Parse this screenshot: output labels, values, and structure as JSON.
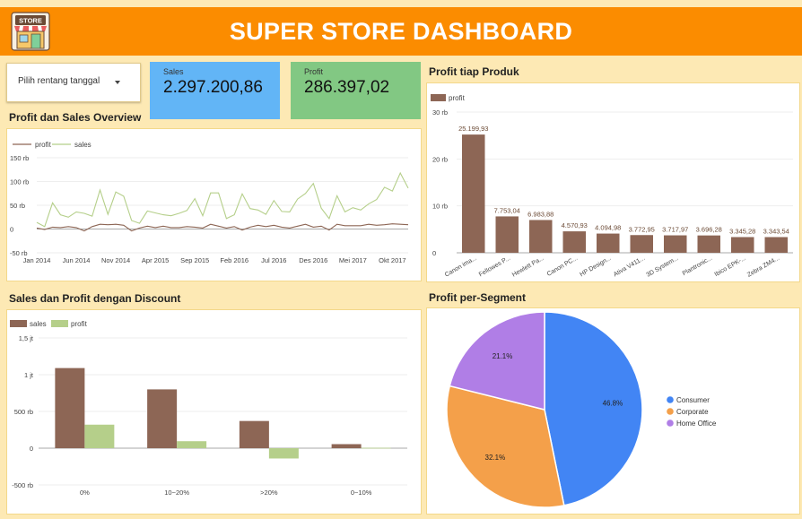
{
  "header": {
    "title": "SUPER STORE DASHBOARD",
    "logo_text": "STORE",
    "logo_icon": "store-icon"
  },
  "date_picker": {
    "label": "Pilih rentang tanggal",
    "icon": "chevron-down-icon"
  },
  "kpis": {
    "sales": {
      "label": "Sales",
      "value": "2.297.200,86"
    },
    "profit": {
      "label": "Profit",
      "value": "286.397,02"
    }
  },
  "colors": {
    "header": "#fb8c00",
    "background": "#fde9b4",
    "sales_card": "#62b5f6",
    "profit_card": "#82c883",
    "brown": "#8d6655",
    "green": "#b5cf8a",
    "consumer": "#4285f4",
    "corporate": "#f4a04a",
    "home_office": "#b07ee6"
  },
  "sections": {
    "overview_title": "Profit dan Sales Overview",
    "discount_title": "Sales dan Profit dengan Discount",
    "product_title": "Profit tiap Produk",
    "segment_title": "Profit per-Segment"
  },
  "chart_data": [
    {
      "id": "overview",
      "type": "line",
      "title": "Profit dan Sales Overview",
      "x": [
        "Jan 2014",
        "Feb 2014",
        "Mar 2014",
        "Apr 2014",
        "May 2014",
        "Jun 2014",
        "Jul 2014",
        "Aug 2014",
        "Sep 2014",
        "Oct 2014",
        "Nov 2014",
        "Dec 2014",
        "Jan 2015",
        "Feb 2015",
        "Mar 2015",
        "Apr 2015",
        "May 2015",
        "Jun 2015",
        "Jul 2015",
        "Aug 2015",
        "Sep 2015",
        "Oct 2015",
        "Nov 2015",
        "Dec 2015",
        "Jan 2016",
        "Feb 2016",
        "Mar 2016",
        "Apr 2016",
        "May 2016",
        "Jun 2016",
        "Jul 2016",
        "Aug 2016",
        "Sep 2016",
        "Oct 2016",
        "Nov 2016",
        "Dec 2016",
        "Jan 2017",
        "Feb 2017",
        "Mar 2017",
        "Apr 2017",
        "May 2017",
        "Jun 2017",
        "Jul 2017",
        "Aug 2017",
        "Sep 2017",
        "Oct 2017",
        "Nov 2017",
        "Dec 2017"
      ],
      "x_tick_labels": [
        "Jan 2014",
        "Jun 2014",
        "Nov 2014",
        "Apr 2015",
        "Sep 2015",
        "Feb 2016",
        "Jul 2016",
        "Des 2016",
        "Mei 2017",
        "Okt 2017"
      ],
      "x_tick_indices": [
        0,
        5,
        10,
        15,
        20,
        25,
        30,
        35,
        40,
        45
      ],
      "y_tick_labels": [
        "150 rb",
        "100 rb",
        "50 rb",
        "0",
        "-50 rb"
      ],
      "y_ticks": [
        150000,
        100000,
        50000,
        0,
        -50000
      ],
      "ylim": [
        -50000,
        150000
      ],
      "series": [
        {
          "name": "profit",
          "values": [
            2000,
            -1000,
            4000,
            3000,
            5000,
            3000,
            -4000,
            5000,
            10000,
            9000,
            10000,
            8000,
            -4000,
            2000,
            6000,
            3000,
            6000,
            3000,
            3000,
            5000,
            4000,
            2000,
            10000,
            6000,
            2000,
            5000,
            -2000,
            4000,
            8000,
            5000,
            8000,
            4000,
            2000,
            6000,
            10000,
            4000,
            6000,
            -2000,
            10000,
            7000,
            7000,
            7000,
            10000,
            8000,
            9000,
            11000,
            10000,
            9000
          ]
        },
        {
          "name": "sales",
          "values": [
            14000,
            5000,
            55000,
            30000,
            25000,
            36000,
            33000,
            27000,
            82000,
            31000,
            78000,
            69000,
            18000,
            12000,
            38000,
            34000,
            30000,
            28000,
            33000,
            39000,
            64000,
            28000,
            76000,
            76000,
            22000,
            30000,
            74000,
            43000,
            40000,
            31000,
            60000,
            37000,
            36000,
            63000,
            75000,
            96000,
            44000,
            22000,
            70000,
            36000,
            45000,
            40000,
            53000,
            62000,
            88000,
            80000,
            118000,
            86000
          ]
        }
      ]
    },
    {
      "id": "discount",
      "type": "bar",
      "title": "Sales dan Profit dengan Discount",
      "categories": [
        "0%",
        "10~20%",
        ">20%",
        "0~10%"
      ],
      "y_tick_labels": [
        "1,5 jt",
        "1 jt",
        "500 rb",
        "0",
        "-500 rb"
      ],
      "y_ticks": [
        1500000,
        1000000,
        500000,
        0,
        -500000
      ],
      "ylim": [
        -500000,
        1500000
      ],
      "series": [
        {
          "name": "sales",
          "values": [
            1090000,
            800000,
            370000,
            55000
          ]
        },
        {
          "name": "profit",
          "values": [
            320000,
            95000,
            -140000,
            5000
          ]
        }
      ]
    },
    {
      "id": "product",
      "type": "bar",
      "title": "Profit tiap Produk",
      "categories": [
        "Canon ima...",
        "Fellowes P...",
        "Hewlett Pa...",
        "Canon PC...",
        "HP Design...",
        "Ativa V411...",
        "3D System...",
        "Plantronic...",
        "Ibico EPK-...",
        "Zebra ZM4..."
      ],
      "data_labels": [
        "25.199,93",
        "7.753,04",
        "6.983,88",
        "4.570,93",
        "4.094,98",
        "3.772,95",
        "3.717,97",
        "3.696,28",
        "3.345,28",
        "3.343,54"
      ],
      "y_tick_labels": [
        "30 rb",
        "20 rb",
        "10 rb",
        "0"
      ],
      "y_ticks": [
        30000,
        20000,
        10000,
        0
      ],
      "ylim": [
        0,
        30000
      ],
      "series": [
        {
          "name": "profit",
          "values": [
            25199.93,
            7753.04,
            6983.88,
            4570.93,
            4094.98,
            3772.95,
            3717.97,
            3696.28,
            3345.28,
            3343.54
          ]
        }
      ]
    },
    {
      "id": "segment",
      "type": "pie",
      "title": "Profit per-Segment",
      "categories": [
        "Consumer",
        "Corporate",
        "Home Office"
      ],
      "values": [
        46.8,
        32.1,
        21.1
      ],
      "data_labels": [
        "46.8%",
        "32.1%",
        "21.1%"
      ],
      "legend_position": "right"
    }
  ]
}
